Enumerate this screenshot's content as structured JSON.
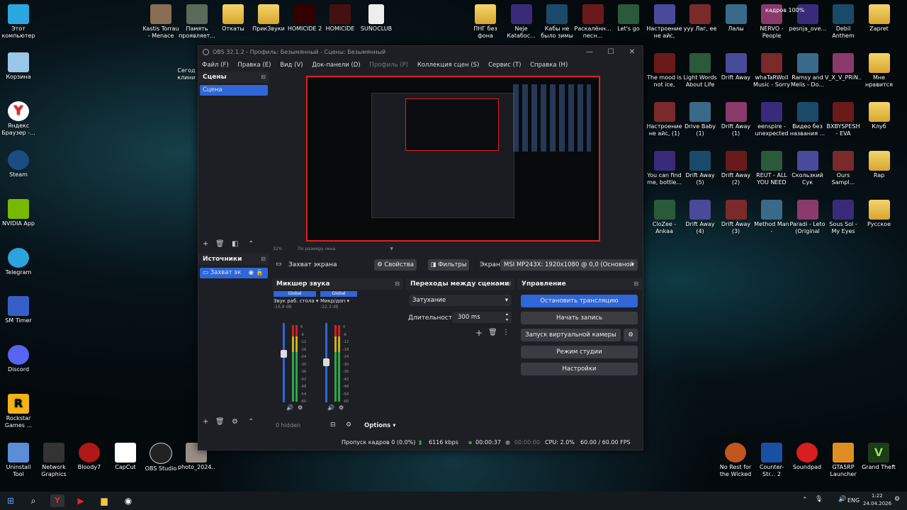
{
  "desktop": {
    "left_icons": [
      "Этот компьютер",
      "Корзина",
      "Яндекс Браузер -...",
      "Steam",
      "NVIDIA App",
      "Telegram",
      "SM Timer",
      "Discord",
      "Rockstar Games ..."
    ],
    "bottom_left_icons": [
      "Uninstall Tool",
      "Network Graphics",
      "Bloody7",
      "CapCut",
      "OBS Studio",
      "photo_2024..."
    ],
    "top_icons": [
      "Kastis Torrau - Menace",
      "Память проявляет...",
      "Откаты",
      "ПрикЗвуки",
      "HOMICIDE 2",
      "HOMICIDE",
      "SUNOCLUB"
    ],
    "seg_label": "Сегод клини",
    "right_row1": [
      "ПНГ без фона",
      "Neje Каtaбос...",
      "Кабы не было зимы",
      "Раскалённ... песн...",
      "Let's go",
      "Настроение не айс,",
      "ууу Лаг, ее",
      "Лалы",
      "NERVO - People Grin...",
      "pesnja_ove...",
      "Debil Anthem",
      "Zapret"
    ],
    "right_row2": [
      "The mood is not ice,",
      "Light Words About Life (1)",
      "Drift Away",
      "whaTaRWoll Music - Sorry",
      "Ramsy and Melis - Do...",
      "V_X_V_PRiN...",
      "Мне нравится"
    ],
    "right_row3": [
      "Настроение не айс, (1)",
      "Drive Baby (1)",
      "Drift Away (1)",
      "eenspire - unexpected",
      "Видео без названия ...",
      "BXBYSPESH - EVA",
      "Клуб"
    ],
    "right_row4": [
      "You can find me, bottle...",
      "Drift Away (5)",
      "Drift Away (2)",
      "REUT - ALL YOU NEED",
      "Скользкий Сук",
      "Ours Sampl...",
      "Rap"
    ],
    "right_row5": [
      "CloZee - Ankaa",
      "Drift Away (4)",
      "Drift Away (3)",
      "Method Man - Presented...",
      "Paradi - Leto (Original Mix)",
      "Sous Sol - My Eyes",
      "Русское"
    ],
    "bottom_right_icons": [
      "No Rest for the Wicked",
      "Counter-Str... 2",
      "Soundpad",
      "GTA5RP Launcher",
      "Grand Theft"
    ],
    "top_right_overlay": "кадров 100%"
  },
  "obs": {
    "title": "OBS 32.1.2 - Профиль: Безымянный - Сцены: Безымянный",
    "menu": [
      "Файл (F)",
      "Правка (E)",
      "Вид (V)",
      "Док-панели (D)",
      "Профиль (P)",
      "Коллекция сцен (S)",
      "Сервис (T)",
      "Справка (H)"
    ],
    "scenes": {
      "title": "Сцены",
      "items": [
        "Сцена"
      ]
    },
    "sources": {
      "title": "Источники",
      "items": [
        "Захват эк"
      ]
    },
    "preview_zoom": "32%",
    "preview_fit": "По размеру окна",
    "source_bar": {
      "name": "Захват экрана",
      "properties": "Свойства",
      "filters": "Фильтры",
      "screen_label": "Экран",
      "screen_value": "MSI MP243X: 1920x1080 @ 0,0 (Основной"
    },
    "mixer": {
      "title": "Микшер звука",
      "channels": [
        {
          "label": "Звук раб. стола",
          "tag": "Global",
          "db": "-16.8 dB"
        },
        {
          "label": "Микр/доп",
          "tag": "Global",
          "db": "-22.3 dB"
        }
      ],
      "ticks": [
        "0",
        "-6",
        "-12",
        "-18",
        "-24",
        "-30",
        "-36",
        "-42",
        "-48",
        "-54",
        "-60"
      ],
      "hidden": "0 hidden",
      "options": "Options"
    },
    "transitions": {
      "title": "Переходы между сценами",
      "type": "Затухание",
      "duration_label": "Длительность",
      "duration": "300 ms"
    },
    "controls": {
      "title": "Управление",
      "stop_stream": "Остановить трансляцию",
      "start_record": "Начать запись",
      "virtual_cam": "Запуск виртуальной камеры",
      "studio_mode": "Режим студии",
      "settings": "Настройки"
    },
    "status": {
      "dropped": "Пропуск кадров 0 (0.0%)",
      "bitrate": "6116 kbps",
      "stream_time": "00:00:37",
      "rec_time": "00:00:00",
      "cpu": "CPU: 2.0%",
      "fps": "60.00 / 60.00 FPS"
    }
  },
  "taskbar": {
    "lang": "ENG",
    "time": "1:22",
    "date": "24.04.2026"
  },
  "colors": {
    "accent": "#2f66d8",
    "live_red": "#e0201f",
    "panel": "#1e1f24"
  }
}
